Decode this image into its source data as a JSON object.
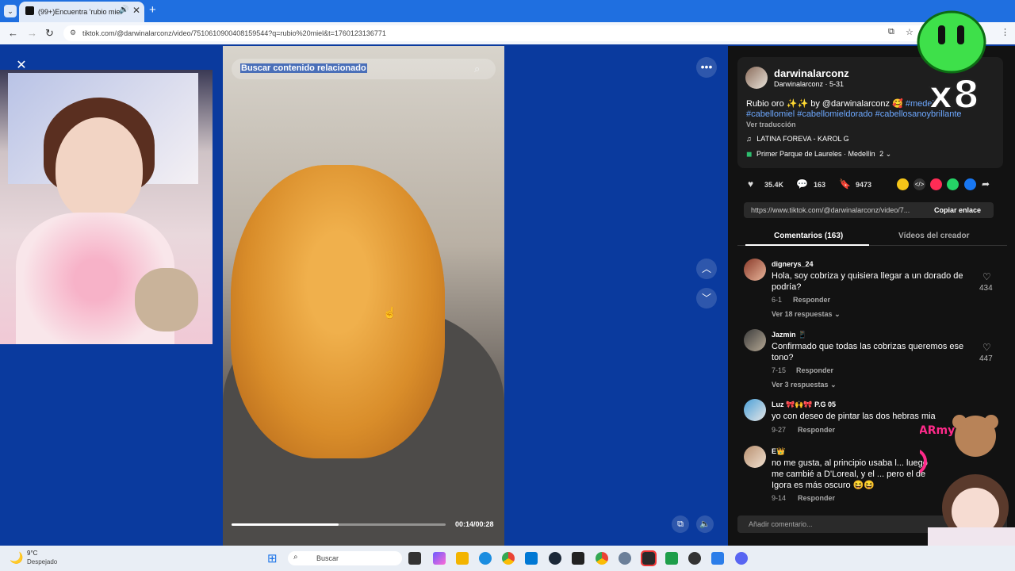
{
  "browser": {
    "tab_title": "(99+)Encuentra 'rubio miel'",
    "url": "tiktok.com/@darwinalarconz/video/7510610900408159544?q=rubio%20miel&t=1760123136771"
  },
  "video": {
    "search_text": "Buscar contenido relacionado",
    "time": "00:14/00:28",
    "progress": 0.5
  },
  "post": {
    "username": "darwinalarconz",
    "subline": "Darwinalarconz · 5-31",
    "caption_pre": "Rubio oro ✨✨ by @darwinalarconz 🥰",
    "caption_tag1": "#medel",
    "caption_tags": "#cabellomiel #cabellomieldorado #cabellosanoybrillante",
    "translate": "Ver traducción",
    "music": "LATINA FOREVA - KAROL G",
    "location": "Primer Parque de Laureles · Medellín",
    "location_more": "2",
    "likes": "35.4K",
    "comments_count": "163",
    "saves": "9473",
    "share_url": "https://www.tiktok.com/@darwinalarconz/video/7...",
    "copy_link": "Copiar enlace",
    "tab_comments": "Comentarios (163)",
    "tab_creator": "Vídeos del creador"
  },
  "comments": [
    {
      "name": "dignerys_24",
      "text": "Hola, soy cobriza y quisiera llegar a un dorado de podría?",
      "date": "6-1",
      "reply": "Responder",
      "more": "Ver 18 respuestas",
      "likes": "434"
    },
    {
      "name": "Jazmin 📱",
      "text": "Confirmado que todas las cobrizas queremos ese tono?",
      "date": "7-15",
      "reply": "Responder",
      "more": "Ver 3 respuestas",
      "likes": "447"
    },
    {
      "name": "Luz 🎀🙌🎀 P.G 05",
      "text": "yo con deseo de pintar las dos hebras mia",
      "date": "9-27",
      "reply": "Responder",
      "more": "",
      "likes": ""
    },
    {
      "name": "E👑",
      "text": "no me gusta, al principio usaba l... luego me cambié a D'Loreal, y el ... pero el de Igora es más oscuro 😆😆",
      "date": "9-14",
      "reply": "Responder",
      "more": "",
      "likes": ""
    }
  ],
  "comment_placeholder": "Añadir comentario...",
  "overlay": {
    "x8": "x8",
    "bear_text": "IJenz BEARmy"
  },
  "taskbar": {
    "temp": "9°C",
    "weather": "Despejado",
    "search": "Buscar"
  },
  "colors": {
    "background": "#0a3a9e",
    "panel": "#121212",
    "hashtag": "#6da8ff"
  }
}
